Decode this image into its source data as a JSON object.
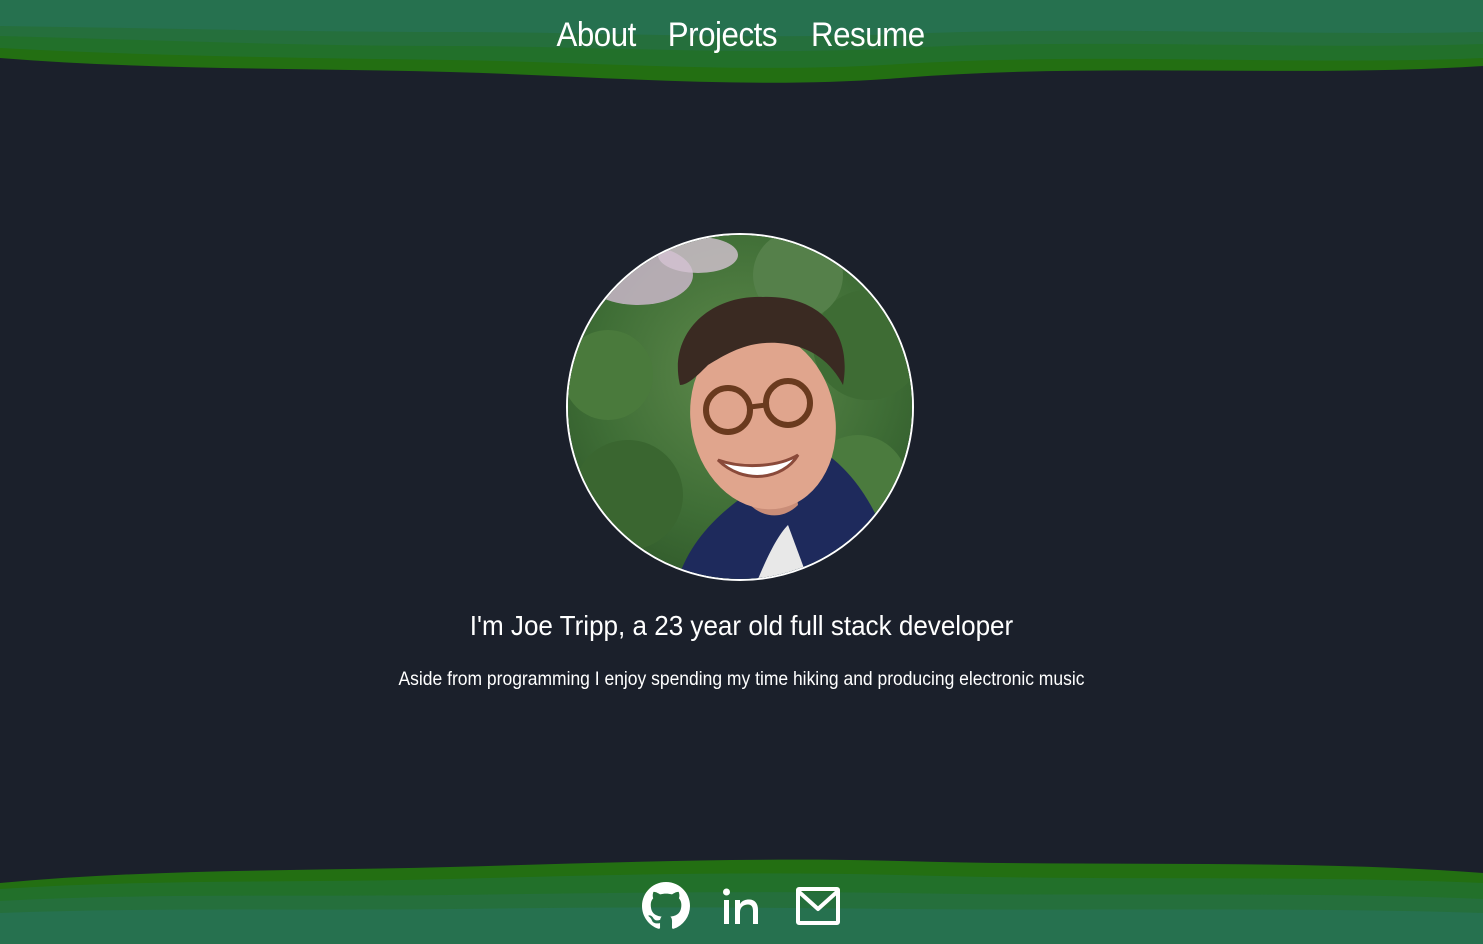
{
  "nav": {
    "items": [
      {
        "label": "About"
      },
      {
        "label": "Projects"
      },
      {
        "label": "Resume"
      }
    ]
  },
  "profile": {
    "headline": "I'm Joe Tripp, a 23 year old full stack developer",
    "subline": "Aside from programming I enjoy spending my time hiking and producing electronic music"
  },
  "social": {
    "links": [
      {
        "icon": "github-icon"
      },
      {
        "icon": "linkedin-icon"
      },
      {
        "icon": "mail-icon"
      }
    ]
  },
  "colors": {
    "background": "#1b202b",
    "wave_dark": "#1f6b1b",
    "wave_mid": "#22742a",
    "wave_teal": "#26744f",
    "text": "#ffffff"
  }
}
